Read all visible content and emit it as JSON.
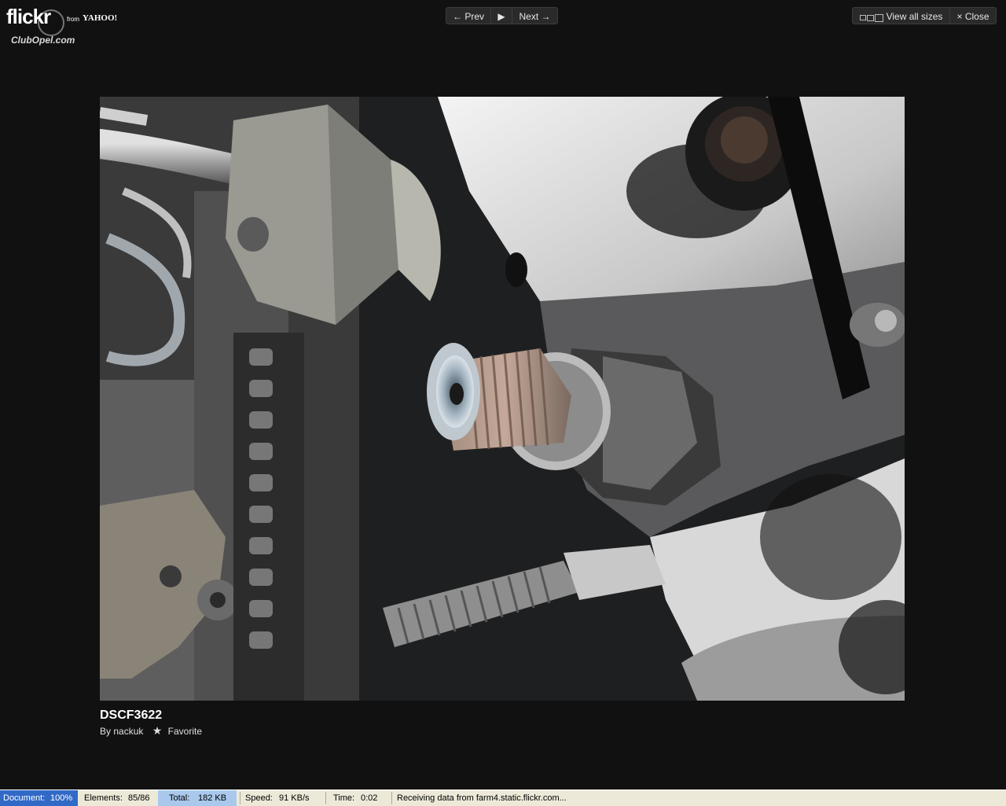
{
  "logo": {
    "brand": "flickr",
    "from": "from",
    "yahoo": "YAHOO!",
    "watermark": "ClubOpel.com"
  },
  "nav": {
    "prev_label": "← Prev",
    "play_label": "▶",
    "next_label": "Next →",
    "view_all_label": "View all sizes",
    "close_label": "× Close"
  },
  "photo": {
    "title": "DSCF3622",
    "by_label": "By",
    "author": "nackuk",
    "favorite_label": "Favorite"
  },
  "statusbar": {
    "document_label": "Document:",
    "document_value": "100%",
    "elements_label": "Elements:",
    "elements_value": "85/86",
    "total_label": "Total:",
    "total_value": "182 KB",
    "speed_label": "Speed:",
    "speed_value": "91 KB/s",
    "time_label": "Time:",
    "time_value": "0:02",
    "message": "Receiving data from farm4.static.flickr.com..."
  },
  "colors": {
    "background": "#111111",
    "statusbar": "#ece9d8",
    "status_highlight": "#3169c6"
  }
}
